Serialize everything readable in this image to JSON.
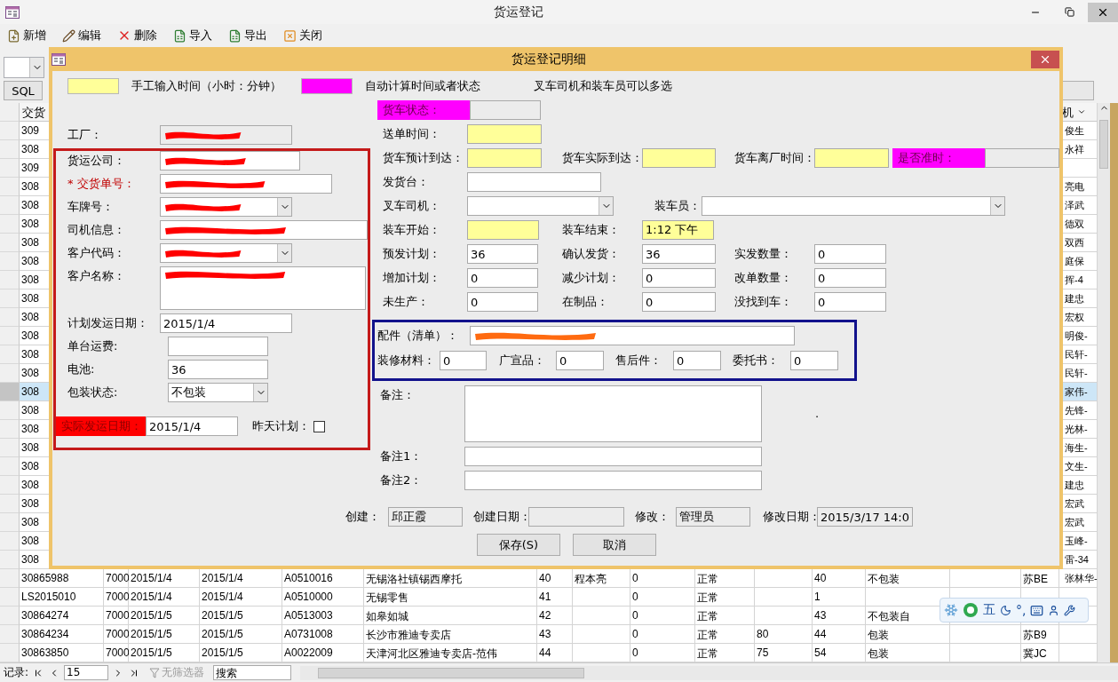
{
  "window": {
    "title": "货运登记"
  },
  "toolbar": [
    {
      "label": "新增",
      "kind": "new"
    },
    {
      "label": "编辑",
      "kind": "edit"
    },
    {
      "label": "删除",
      "kind": "delete"
    },
    {
      "label": "导入",
      "kind": "import"
    },
    {
      "label": "导出",
      "kind": "export"
    },
    {
      "label": "关闭",
      "kind": "close"
    }
  ],
  "sql_button": "SQL",
  "datasheet": {
    "header": {
      "col_1": "交货",
      "col_16": "机"
    },
    "rows": [
      {
        "selected": false,
        "cells": {
          "col_1": "309",
          "col_16": "俊生"
        }
      },
      {
        "selected": false,
        "cells": {
          "col_1": "308",
          "col_16": "永祥"
        }
      },
      {
        "selected": false,
        "cells": {
          "col_1": "309"
        }
      },
      {
        "selected": false,
        "cells": {
          "col_1": "308",
          "col_16": "亮电"
        }
      },
      {
        "selected": false,
        "cells": {
          "col_1": "308",
          "col_16": "泽武"
        }
      },
      {
        "selected": false,
        "cells": {
          "col_1": "308",
          "col_16": "德双"
        }
      },
      {
        "selected": false,
        "cells": {
          "col_1": "308",
          "col_16": "双西"
        }
      },
      {
        "selected": false,
        "cells": {
          "col_1": "308",
          "col_16": "庭保"
        }
      },
      {
        "selected": false,
        "cells": {
          "col_1": "308",
          "col_16": "挥-4"
        }
      },
      {
        "selected": false,
        "cells": {
          "col_1": "308",
          "col_16": "建忠"
        }
      },
      {
        "selected": false,
        "cells": {
          "col_1": "308",
          "col_16": "宏权"
        }
      },
      {
        "selected": false,
        "cells": {
          "col_1": "308",
          "col_16": "明俊-"
        }
      },
      {
        "selected": false,
        "cells": {
          "col_1": "308",
          "col_16": "民轩-"
        }
      },
      {
        "selected": false,
        "cells": {
          "col_1": "308",
          "col_16": "民轩-"
        }
      },
      {
        "selected": true,
        "cells": {
          "col_1": "308",
          "col_16": "家伟-"
        }
      },
      {
        "selected": false,
        "cells": {
          "col_1": "308",
          "col_16": "先锋-"
        }
      },
      {
        "selected": false,
        "cells": {
          "col_1": "308",
          "col_16": "光林-"
        }
      },
      {
        "selected": false,
        "cells": {
          "col_1": "308",
          "col_16": "海生-"
        }
      },
      {
        "selected": false,
        "cells": {
          "col_1": "308",
          "col_16": "文生-"
        }
      },
      {
        "selected": false,
        "cells": {
          "col_1": "308",
          "col_16": "建忠"
        }
      },
      {
        "selected": false,
        "cells": {
          "col_1": "308",
          "col_16": "宏武"
        }
      },
      {
        "selected": false,
        "cells": {
          "col_1": "308",
          "col_16": "宏武"
        }
      },
      {
        "selected": false,
        "cells": {
          "col_1": "308",
          "col_16": "玉峰-"
        }
      },
      {
        "selected": false,
        "cells": {
          "col_1": "308",
          "col_16": "雷-34"
        }
      },
      {
        "selected": false,
        "cells": {
          "col_1": "30865988",
          "col_2": "7000",
          "col_3": "2015/1/4",
          "col_4": "2015/1/4",
          "col_5": "A0510016",
          "col_6": "无锡洛社镇锡西摩托",
          "col_7": "40",
          "col_8": "程本亮",
          "col_9": "0",
          "col_10": "正常",
          "col_12": "40",
          "col_13": "不包装",
          "col_15": "苏BE",
          "col_16": "张林华-"
        }
      },
      {
        "selected": false,
        "cells": {
          "col_1": "LS2015010",
          "col_2": "7000",
          "col_3": "2015/1/4",
          "col_4": "2015/1/4",
          "col_5": "A0510000",
          "col_6": "无锡零售",
          "col_7": "41",
          "col_9": "0",
          "col_10": "正常",
          "col_12": "1"
        }
      },
      {
        "selected": false,
        "cells": {
          "col_1": "30864274",
          "col_2": "7000",
          "col_3": "2015/1/5",
          "col_4": "2015/1/5",
          "col_5": "A0513003",
          "col_6": "如皋如城",
          "col_7": "42",
          "col_9": "0",
          "col_10": "正常",
          "col_12": "43",
          "col_13": "不包装自"
        }
      },
      {
        "selected": false,
        "cells": {
          "col_1": "30864234",
          "col_2": "7000",
          "col_3": "2015/1/5",
          "col_4": "2015/1/5",
          "col_5": "A0731008",
          "col_6": "长沙市雅迪专卖店",
          "col_7": "43",
          "col_9": "0",
          "col_10": "正常",
          "col_11": "80",
          "col_12": "44",
          "col_13": "包装",
          "col_15": "苏B9"
        }
      },
      {
        "selected": false,
        "cells": {
          "col_1": "30863850",
          "col_2": "7000",
          "col_3": "2015/1/5",
          "col_4": "2015/1/5",
          "col_5": "A0022009",
          "col_6": "天津河北区雅迪专卖店-范伟",
          "col_7": "44",
          "col_9": "0",
          "col_10": "正常",
          "col_11": "75",
          "col_12": "54",
          "col_13": "包装",
          "col_15": "冀JC"
        }
      }
    ]
  },
  "record_nav": {
    "label": "记录:",
    "current": "15",
    "filter": "无筛选器",
    "search_placeholder": "搜索"
  },
  "ime_toolbar": {
    "mode": "五",
    "punctuation": "°,"
  },
  "dialog": {
    "title": "货运登记明细",
    "legend": [
      {
        "color": "#ffff99",
        "text": "手工输入时间（小时：分钟）"
      },
      {
        "color": "#ff00ff",
        "text": "自动计算时间或者状态"
      }
    ],
    "legend_note": "叉车司机和装车员可以多选",
    "factory": {
      "label": "工厂：",
      "kind": "readonly",
      "color": "#ff0000"
    },
    "shipment": [
      {
        "label": "货运公司：",
        "kind": "text",
        "required": false,
        "color": "#ff0000"
      },
      {
        "label": "* 交货单号：",
        "kind": "text",
        "required": true,
        "color": "#ff0000"
      },
      {
        "label": "车牌号：",
        "kind": "combo",
        "required": false,
        "color": "#ff0000"
      },
      {
        "label": "司机信息：",
        "kind": "text",
        "required": false,
        "color": "#ff0000"
      },
      {
        "label": "客户代码：",
        "kind": "combo",
        "required": false,
        "color": "#ff0000"
      },
      {
        "label": "客户名称：",
        "kind": "textarea",
        "required": false,
        "color": "#ff0000"
      },
      {
        "label": "计划发运日期：",
        "kind": "text",
        "required": false,
        "value": "2015/1/4"
      },
      {
        "label": "单台运费:",
        "kind": "text",
        "required": false
      },
      {
        "label": "电池:",
        "kind": "text",
        "required": false,
        "value": "36"
      },
      {
        "label": "包装状态:",
        "kind": "combo",
        "required": false,
        "value": "不包装"
      }
    ],
    "actual_ship": {
      "label": "实际发运日期：",
      "kind": "alert",
      "value": "2015/1/4"
    },
    "yesterday_plan": {
      "label": "昨天计划：",
      "checked": false
    },
    "status_rows": [
      [
        {
          "label": "货车状态：",
          "kind": "status"
        }
      ],
      [
        {
          "label": "送单时间：",
          "kind": "manual"
        }
      ],
      [
        {
          "label": "货车预计到达：",
          "kind": "manual"
        },
        {
          "label": "货车实际到达：",
          "kind": "manual"
        },
        {
          "label": "货车离厂时间：",
          "kind": "manual"
        },
        {
          "label": "是否准时：",
          "kind": "status"
        }
      ],
      [
        {
          "label": "发货台：",
          "kind": "text"
        }
      ],
      [
        {
          "label": "叉车司机：",
          "kind": "combo"
        },
        {
          "label": "装车员：",
          "kind": "combo"
        }
      ],
      [
        {
          "label": "装车开始：",
          "kind": "manual"
        },
        {
          "label": "装车结束：",
          "kind": "manual",
          "value": "1:12 下午"
        }
      ],
      [
        {
          "label": "预发计划：",
          "kind": "text",
          "value": "36"
        },
        {
          "label": "确认发货：",
          "kind": "text",
          "value": "36"
        },
        {
          "label": "实发数量：",
          "kind": "text",
          "value": "0"
        }
      ],
      [
        {
          "label": "增加计划：",
          "kind": "text",
          "value": "0"
        },
        {
          "label": "减少计划：",
          "kind": "text",
          "value": "0"
        },
        {
          "label": "改单数量：",
          "kind": "text",
          "value": "0"
        }
      ],
      [
        {
          "label": "未生产：",
          "kind": "text",
          "value": "0"
        },
        {
          "label": "在制品：",
          "kind": "text",
          "value": "0"
        },
        {
          "label": "没找到车：",
          "kind": "text",
          "value": "0"
        }
      ]
    ],
    "parts_rows": [
      [
        {
          "label": "配件（清单）：",
          "kind": "text",
          "color": "#ff6a10"
        }
      ],
      [
        {
          "label": "装修材料：",
          "kind": "text",
          "value": "0"
        },
        {
          "label": "广宣品：",
          "kind": "text",
          "value": "0"
        },
        {
          "label": "售后件：",
          "kind": "text",
          "value": "0"
        },
        {
          "label": "委托书：",
          "kind": "text",
          "value": "0"
        }
      ]
    ],
    "notes": [
      {
        "label": "备注：",
        "kind": "textarea"
      },
      {
        "label": "备注1：",
        "kind": "text"
      },
      {
        "label": "备注2：",
        "kind": "text"
      }
    ],
    "stray_mark": ".",
    "audit": [
      {
        "label": "创建：",
        "kind": "readonly",
        "value": "邱正霞"
      },
      {
        "label": "创建日期：",
        "kind": "readonly"
      },
      {
        "label": "修改：",
        "kind": "readonly",
        "value": "管理员"
      },
      {
        "label": "修改日期：",
        "kind": "readonly",
        "value": "2015/3/17 14:0"
      }
    ],
    "buttons": [
      {
        "label": "保存(S)"
      },
      {
        "label": "取消"
      }
    ]
  }
}
